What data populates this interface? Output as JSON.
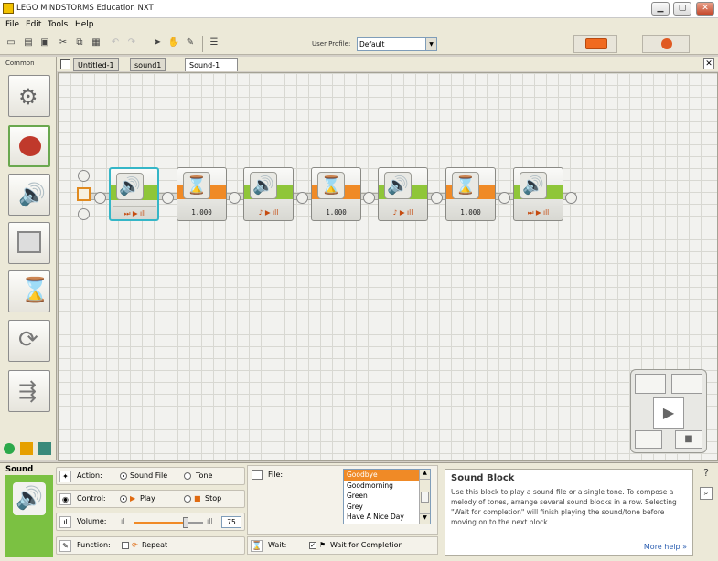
{
  "window": {
    "title": "LEGO MINDSTORMS Education NXT",
    "min": "▁",
    "max": "▢",
    "close": "✕"
  },
  "menu": [
    "File",
    "Edit",
    "Tools",
    "Help"
  ],
  "toolbar": {
    "user_profile_label": "User Profile:",
    "user_profile_value": "Default"
  },
  "palette": {
    "title": "Common"
  },
  "tabs": [
    "Untitled-1",
    "sound1",
    "Sound-1"
  ],
  "program": {
    "blocks": [
      {
        "kind": "sound",
        "foot": "⏭ ▶ ıll"
      },
      {
        "kind": "wait",
        "foot": "1.000"
      },
      {
        "kind": "sound",
        "foot": "♪ ▶ ıll"
      },
      {
        "kind": "wait",
        "foot": "1.000"
      },
      {
        "kind": "sound",
        "foot": "♪ ▶ ıll"
      },
      {
        "kind": "wait",
        "foot": "1.000"
      },
      {
        "kind": "sound",
        "foot": "⏭ ▶ ıll"
      }
    ]
  },
  "config": {
    "block_name": "Sound",
    "action_label": "Action:",
    "action_opt1": "Sound File",
    "action_opt2": "Tone",
    "control_label": "Control:",
    "control_opt1": "Play",
    "control_opt2": "Stop",
    "volume_label": "Volume:",
    "volume_value": "75",
    "volume_fraction": 0.75,
    "function_label": "Function:",
    "function_opt": "Repeat",
    "file_label": "File:",
    "files": [
      "Goodbye",
      "Goodmorning",
      "Green",
      "Grey",
      "Have A Nice Day"
    ],
    "wait_label": "Wait:",
    "wait_opt": "Wait for Completion"
  },
  "help": {
    "title": "Sound Block",
    "body": "Use this block to play a sound file or a single tone. To compose a melody of tones, arrange several sound blocks in a row. Selecting \"Wait for completion\" will finish playing the sound/tone before moving on to the next block.",
    "more": "More help »"
  },
  "colors": {
    "accent_green": "#8fc639",
    "accent_orange": "#f08a26",
    "selection": "#35b6c7"
  }
}
